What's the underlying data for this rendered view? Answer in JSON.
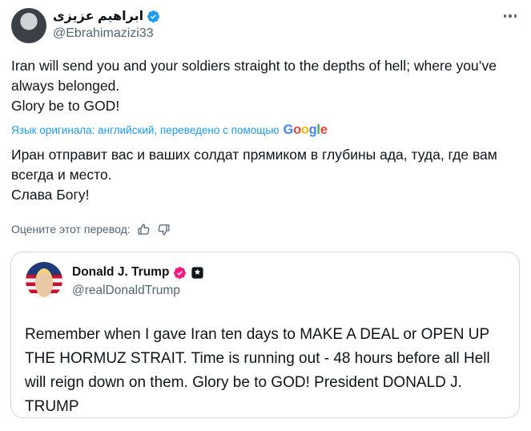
{
  "author": {
    "display_name": "ابراهیم عزیزی",
    "handle": "@Ebrahimazizi33",
    "avatar_icon": "user-avatar",
    "verified_icon": "verified-badge-icon",
    "verified_color": "#1d9bf0"
  },
  "tweet": {
    "text": "Iran will send you and your soldiers straight to the depths of hell; where you’ve always belonged.\nGlory be to GOD!"
  },
  "translation": {
    "note": "Язык оригинала: английский, переведено с помощью",
    "provider": "Google",
    "text": "Иран отправит вас и ваших солдат прямиком в глубины ада, туда, где вам всегда и место.\nСлава Богу!",
    "rate_label": "Оцените этот перевод:"
  },
  "quote": {
    "display_name": "Donald J. Trump",
    "handle": "@realDonaldTrump",
    "badge_color": "#f91880",
    "text": "Remember when I gave Iran ten days to MAKE A DEAL or OPEN UP THE HORMUZ STRAIT. Time is running out - 48 hours before all Hell will reign down on them. Glory be to GOD! President DONALD J. TRUMP"
  },
  "colors": {
    "text": "#0f1419",
    "secondary": "#536471",
    "link": "#1d9bf0",
    "border": "#cfd9de"
  }
}
